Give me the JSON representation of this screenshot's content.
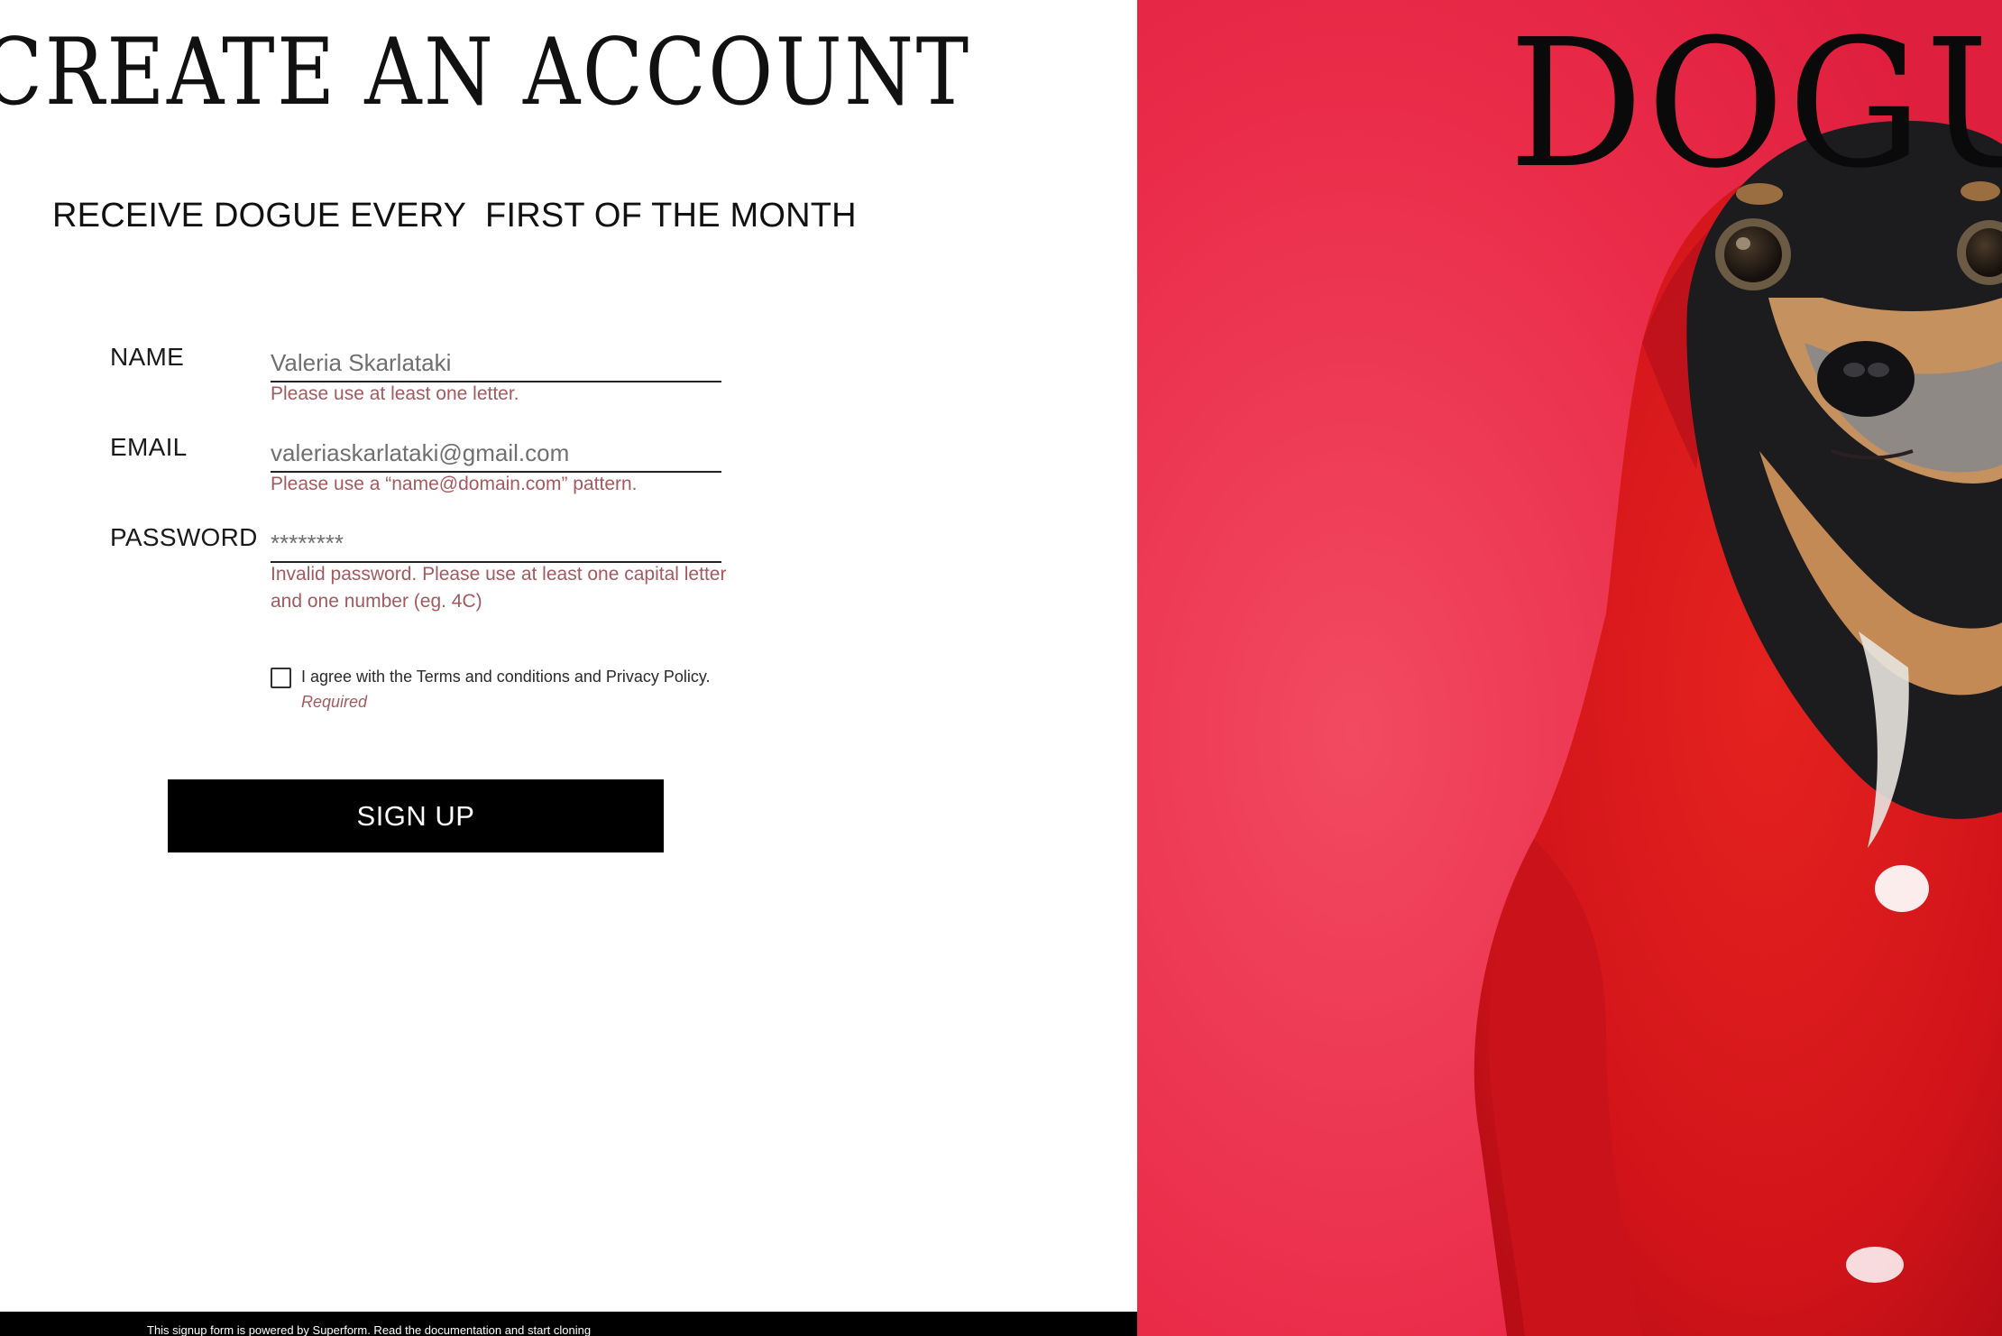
{
  "page": {
    "title": "CREATE AN ACCOUNT",
    "subtitle": "RECEIVE DOGUE EVERY  FIRST OF THE MONTH"
  },
  "form": {
    "name": {
      "label": "NAME",
      "value": "Valeria Skarlataki",
      "error": "Please use at least one letter."
    },
    "email": {
      "label": "EMAIL",
      "value": "valeriaskarlataki@gmail.com",
      "error": "Please use a “name@domain.com” pattern."
    },
    "password": {
      "label": "PASSWORD",
      "value": "********",
      "error": "Invalid password. Please  use at least one capital letter and one number (eg. 4C)"
    },
    "agreement": {
      "text": "I agree with the Terms and conditions and Privacy Policy.",
      "required": "Required",
      "checked": false
    },
    "submit_label": "SIGN UP"
  },
  "footer": {
    "text": "This signup form is powered by Superform. Read the documentation and start cloning"
  },
  "cover": {
    "brand": "DOGUE"
  },
  "colors": {
    "background": "#ffffff",
    "text": "#111111",
    "error": "#a35a5f",
    "button_bg": "#000000",
    "button_text": "#ffffff",
    "cover_bg": "#ea2a48",
    "hoodie": "#d8171d"
  },
  "icons": {
    "checkbox": "checkbox-unchecked-icon"
  }
}
